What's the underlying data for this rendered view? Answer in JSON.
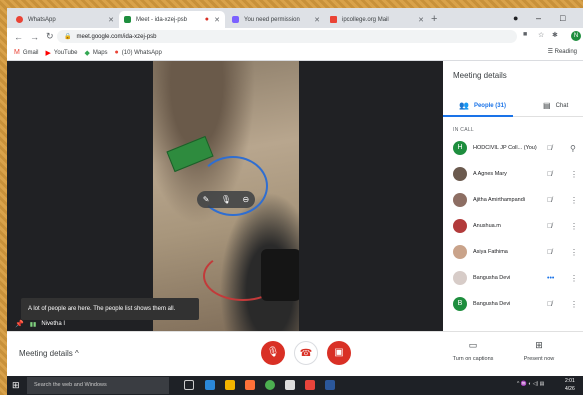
{
  "browser": {
    "tabs": [
      {
        "title": "WhatsApp",
        "favicon_color": "#ea4335",
        "active": false
      },
      {
        "title": "Meet - ida-xzej-psb",
        "favicon_color": "#1e8e3e",
        "active": true
      },
      {
        "title": "You need permission",
        "favicon_color": "#7b61ff",
        "active": false
      },
      {
        "title": "ipcollege.org Mail",
        "favicon_color": "#ea4335",
        "active": false
      }
    ],
    "url": "meet.google.com/ida-xzej-psb",
    "profile_initial": "N",
    "bookmarks": [
      {
        "label": "Gmail",
        "icon": "gmail-icon",
        "color": "#ea4335"
      },
      {
        "label": "YouTube",
        "icon": "youtube-icon",
        "color": "#ff0000"
      },
      {
        "label": "Maps",
        "icon": "maps-icon",
        "color": "#34a853"
      },
      {
        "label": "(10) WhatsApp",
        "icon": "whatsapp-icon",
        "color": "#ea4335"
      }
    ],
    "reading_list": "Reading"
  },
  "meet": {
    "toast": "A lot of people are here. The people list shows them all.",
    "self_name": "Nivetha I"
  },
  "panel": {
    "title": "Meeting details",
    "people_tab": "People (31)",
    "chat_tab": "Chat",
    "section": "IN CALL",
    "participants": [
      {
        "name": "HODCIVIL JP Coll...  (You)",
        "avatar_letter": "H",
        "avatar_color": "#1e8e3e"
      },
      {
        "name": "A Agnes Mary",
        "avatar_letter": "",
        "avatar_color": "#6b5a4e"
      },
      {
        "name": "Ajitha Amirthampandi",
        "avatar_letter": "",
        "avatar_color": "#8d6e63"
      },
      {
        "name": "Anushua.m",
        "avatar_letter": "",
        "avatar_color": "#b23b3b"
      },
      {
        "name": "Asiya Fathima",
        "avatar_letter": "",
        "avatar_color": "#c9a38a"
      },
      {
        "name": "Bangusha Devi",
        "avatar_letter": "",
        "avatar_color": "#d7ccc8"
      },
      {
        "name": "Bangusha Devi",
        "avatar_letter": "B",
        "avatar_color": "#1e8e3e"
      }
    ]
  },
  "bottom": {
    "meeting_details": "Meeting details",
    "captions": "Turn on captions",
    "present": "Present now"
  },
  "taskbar": {
    "search": "Search the web and Windows",
    "clock_time": "2:01",
    "clock_date": "4/26"
  }
}
